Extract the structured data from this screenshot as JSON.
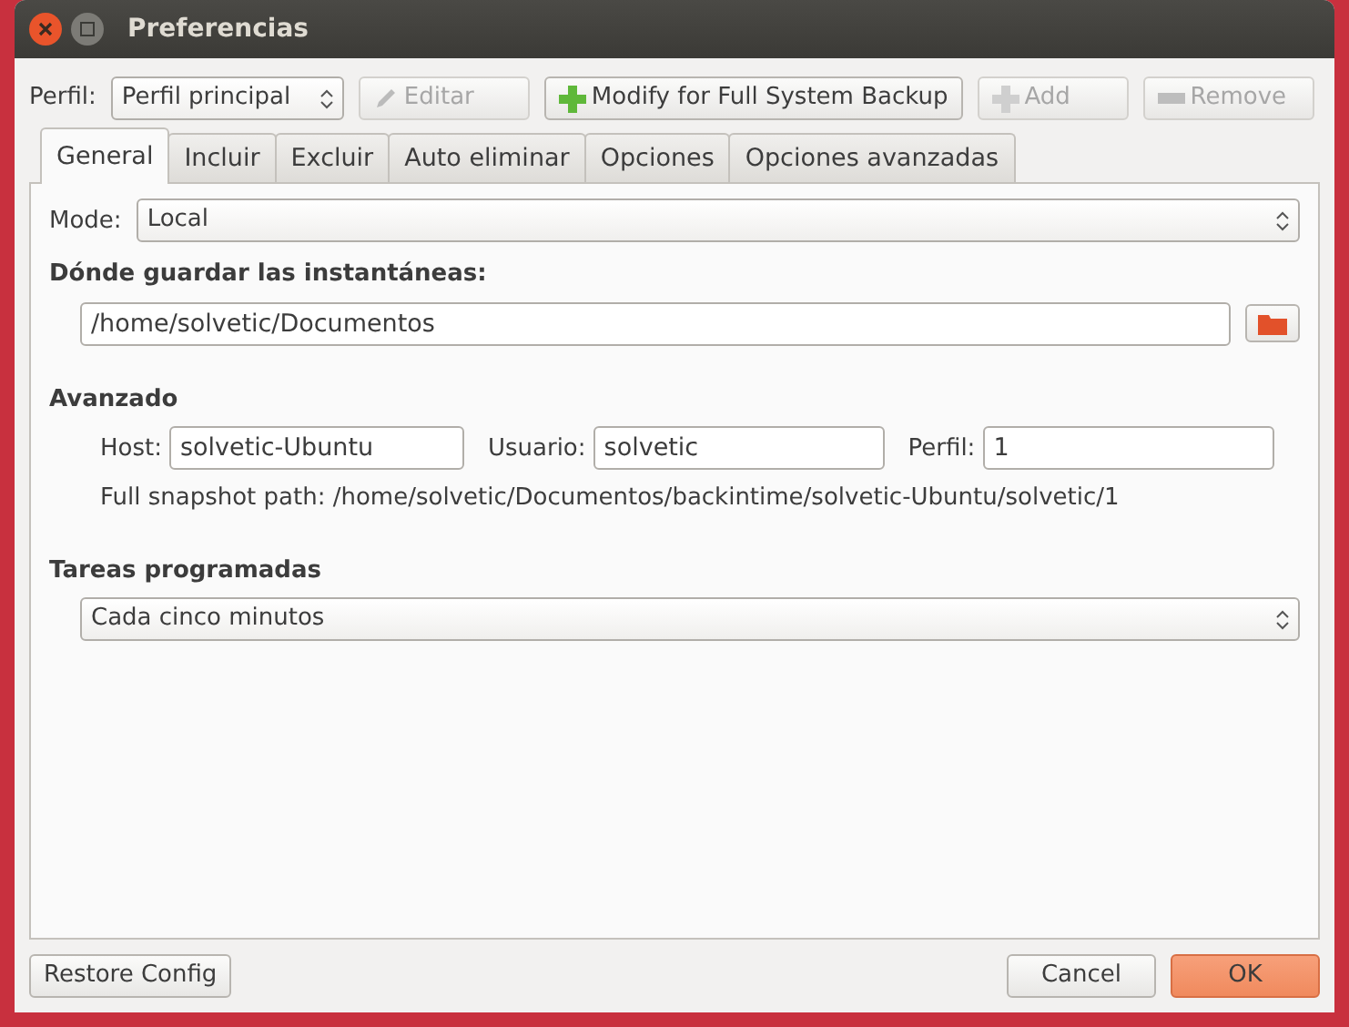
{
  "window": {
    "title": "Preferencias"
  },
  "toolbar": {
    "profile_label": "Perfil:",
    "profile": "Perfil principal",
    "buttons": [
      {
        "label": "Editar",
        "kind": "edit",
        "disabled": true
      },
      {
        "label": "Modify for Full System Backup",
        "kind": "add",
        "disabled": false
      },
      {
        "label": "Add",
        "kind": "add",
        "disabled": true
      },
      {
        "label": "Remove",
        "kind": "remove",
        "disabled": true
      }
    ]
  },
  "tabs": [
    {
      "label": "General",
      "selected": true
    },
    {
      "label": "Incluir",
      "selected": false
    },
    {
      "label": "Excluir",
      "selected": false
    },
    {
      "label": "Auto eliminar",
      "selected": false
    },
    {
      "label": "Opciones",
      "selected": false
    },
    {
      "label": "Opciones avanzadas",
      "selected": false
    }
  ],
  "general": {
    "mode_label": "Mode:",
    "mode": "Local",
    "where_heading": "Dónde guardar las instantáneas:",
    "where_path": "/home/solvetic/Documentos",
    "advanced_heading": "Avanzado",
    "host_label": "Host:",
    "host": "solvetic-Ubuntu",
    "user_label": "Usuario:",
    "user": "solvetic",
    "profile_label": "Perfil:",
    "profile": "1",
    "full_path": "Full snapshot path: /home/solvetic/Documentos/backintime/solvetic-Ubuntu/solvetic/1",
    "schedule_heading": "Tareas programadas",
    "schedule": "Cada cinco minutos"
  },
  "footer": {
    "restore": "Restore Config",
    "cancel": "Cancel",
    "ok": "OK"
  }
}
